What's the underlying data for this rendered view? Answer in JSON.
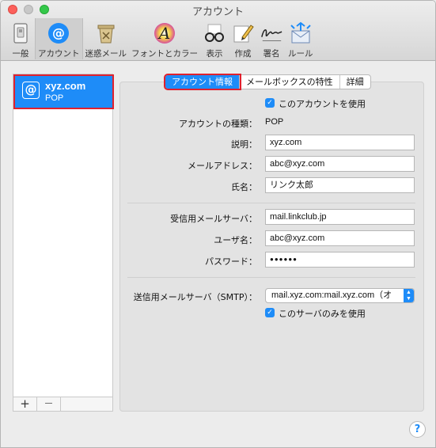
{
  "window": {
    "title": "アカウント"
  },
  "toolbar": {
    "items": [
      {
        "label": "一般",
        "icon": "switch-icon"
      },
      {
        "label": "アカウント",
        "icon": "at-icon"
      },
      {
        "label": "迷惑メール",
        "icon": "trash-icon"
      },
      {
        "label": "フォントとカラー",
        "icon": "font-icon"
      },
      {
        "label": "表示",
        "icon": "glasses-icon"
      },
      {
        "label": "作成",
        "icon": "pencil-icon"
      },
      {
        "label": "署名",
        "icon": "signature-icon"
      },
      {
        "label": "ルール",
        "icon": "rules-icon"
      }
    ]
  },
  "account_list": {
    "items": [
      {
        "name": "xyz.com",
        "type": "POP",
        "icon": "@"
      }
    ],
    "add_label": "+",
    "remove_label": "—"
  },
  "tabs": [
    "アカウント情報",
    "メールボックスの特性",
    "詳細"
  ],
  "account_info": {
    "enable_label": "このアカウントを使用",
    "type_label": "アカウントの種類：",
    "type_value": "POP",
    "description_label": "説明：",
    "description_value": "xyz.com",
    "email_label": "メールアドレス：",
    "email_value": "abc@xyz.com",
    "fullname_label": "氏名：",
    "fullname_value": "リンク太郎",
    "incoming_label": "受信用メールサーバ：",
    "incoming_value": "mail.linkclub.jp",
    "username_label": "ユーザ名：",
    "username_value": "abc@xyz.com",
    "password_label": "パスワード：",
    "password_value": "●●●●●●",
    "smtp_label": "送信用メールサーバ（SMTP）：",
    "smtp_value": "mail.xyz.com:mail.xyz.com（オ",
    "smtp_only_label": "このサーバのみを使用"
  },
  "help": {
    "label": "?"
  },
  "colors": {
    "accent": "#1e8cf8",
    "highlight_border": "#e0212e"
  }
}
